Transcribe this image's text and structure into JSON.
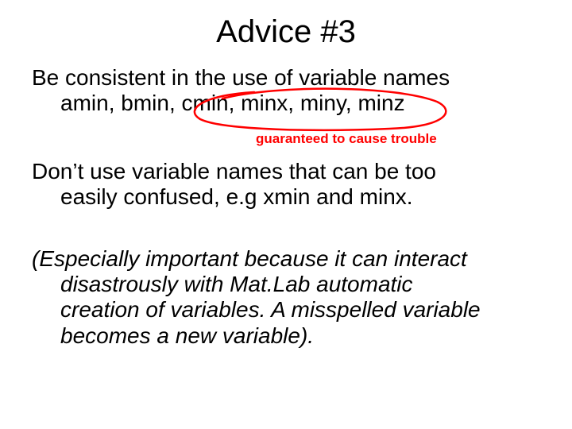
{
  "title": "Advice #3",
  "p1_line1": "Be consistent in the use of variable names",
  "p1_line2": "amin, bmin, cmin, minx, miny, minz",
  "annotation": "guaranteed to cause trouble",
  "p2_line1": "Don’t use variable names that can be too",
  "p2_line2": "easily confused, e.g xmin and minx.",
  "p3_line1": "(Especially important because it can interact",
  "p3_line2": "disastrously with Mat.Lab automatic",
  "p3_line3": "creation of variables. A misspelled variable",
  "p3_line4": "becomes a new variable).",
  "colors": {
    "annotation_red": "#ff0000"
  }
}
